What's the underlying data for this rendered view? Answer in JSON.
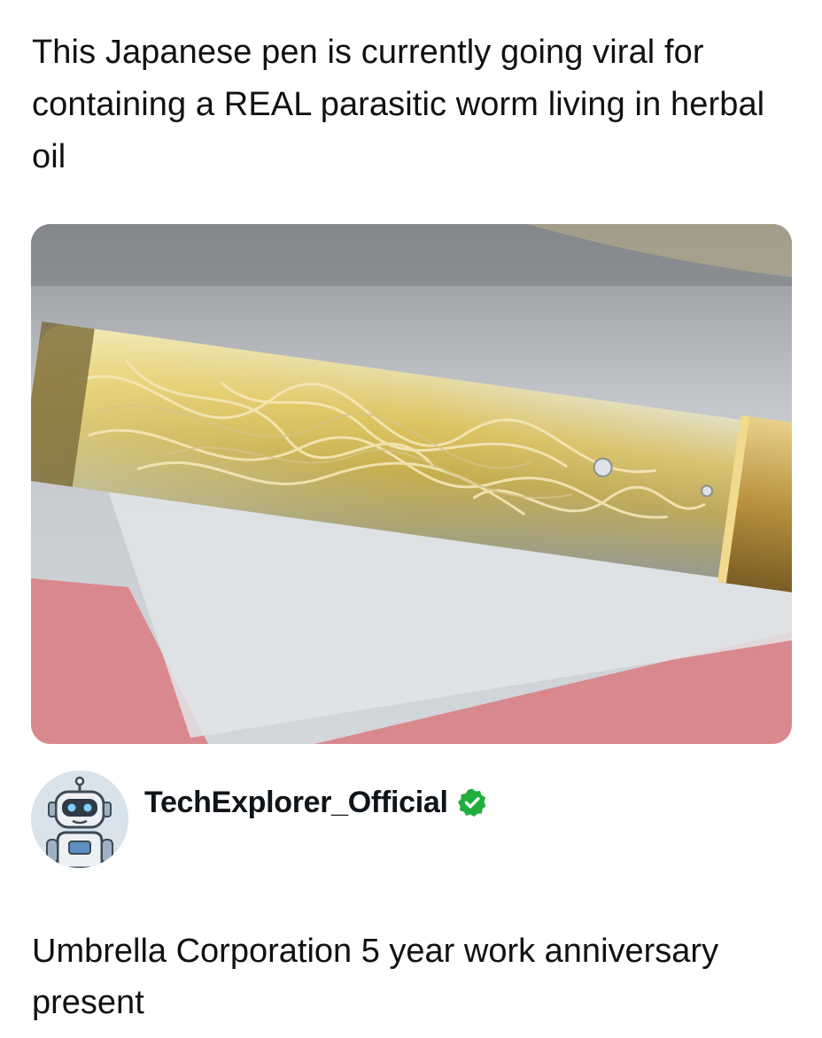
{
  "post": {
    "caption": "This Japanese pen is currently going viral for containing a REAL parasitic worm living in herbal oil"
  },
  "author": {
    "name": "TechExplorer_Official",
    "avatar_icon": "robot-icon",
    "badge_icon": "verified-check-icon",
    "badge_color": "#1fae3b"
  },
  "reply": {
    "text": "Umbrella Corporation 5 year work anniversary present"
  },
  "colors": {
    "background": "#ffffff",
    "text": "#111111"
  }
}
